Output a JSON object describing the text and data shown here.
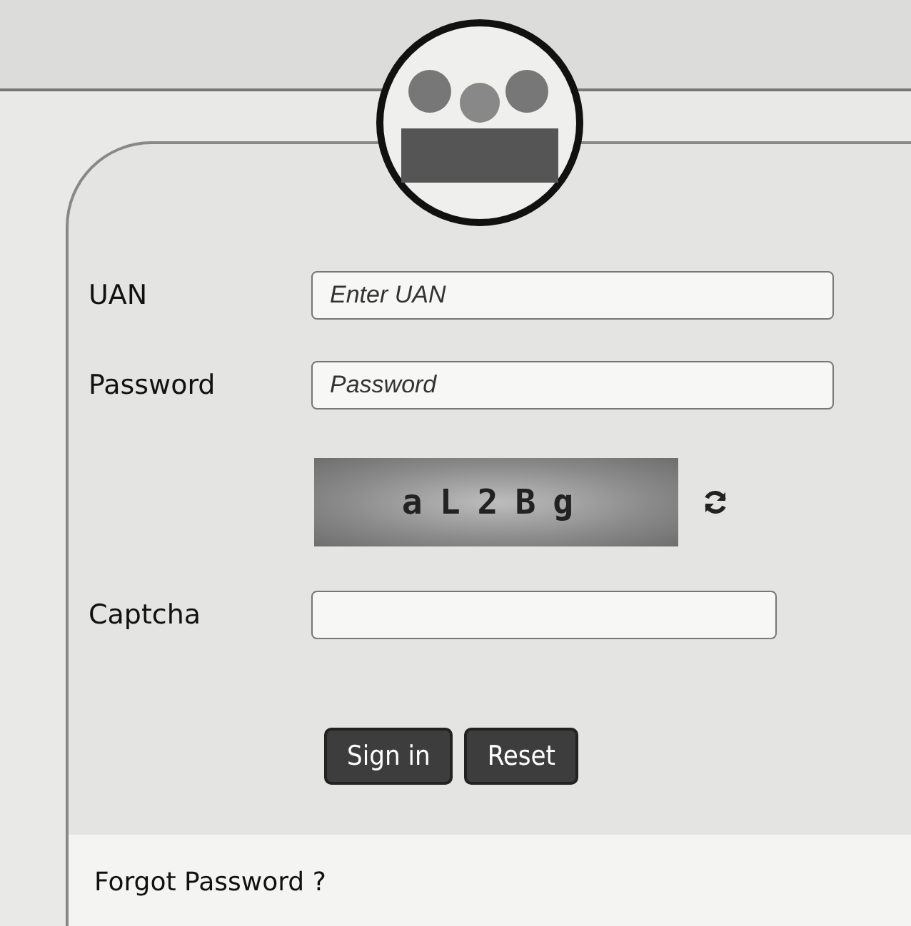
{
  "form": {
    "fields": [
      {
        "kind": "text",
        "label": "UAN",
        "placeholder": "Enter UAN"
      },
      {
        "kind": "text",
        "label": "Password",
        "placeholder": "Password"
      }
    ],
    "captcha": {
      "text": "aL2Bg",
      "label": "Captcha"
    },
    "buttons": [
      "Sign in",
      "Reset"
    ],
    "footer_link": "Forgot Password ?"
  }
}
